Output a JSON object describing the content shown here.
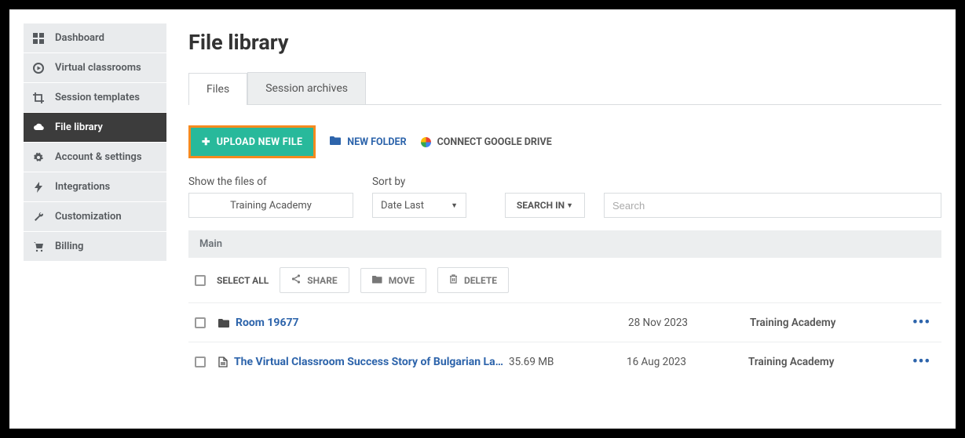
{
  "page_title": "File library",
  "sidebar": {
    "items": [
      {
        "id": "dashboard",
        "label": "Dashboard",
        "active": false
      },
      {
        "id": "virtual-classrooms",
        "label": "Virtual classrooms",
        "active": false
      },
      {
        "id": "session-templates",
        "label": "Session templates",
        "active": false
      },
      {
        "id": "file-library",
        "label": "File library",
        "active": true
      },
      {
        "id": "account-settings",
        "label": "Account & settings",
        "active": false
      },
      {
        "id": "integrations",
        "label": "Integrations",
        "active": false
      },
      {
        "id": "customization",
        "label": "Customization",
        "active": false
      },
      {
        "id": "billing",
        "label": "Billing",
        "active": false
      }
    ]
  },
  "tabs": [
    {
      "id": "files",
      "label": "Files",
      "active": true
    },
    {
      "id": "session-archives",
      "label": "Session archives",
      "active": false
    }
  ],
  "actions": {
    "upload_label": "UPLOAD NEW FILE",
    "new_folder_label": "NEW FOLDER",
    "connect_drive_label": "CONNECT GOOGLE DRIVE"
  },
  "filters": {
    "show_files_label": "Show the files of",
    "show_files_value": "Training Academy",
    "sort_by_label": "Sort by",
    "sort_by_value": "Date Last",
    "search_in_label": "SEARCH IN",
    "search_placeholder": "Search"
  },
  "breadcrumb": "Main",
  "toolbar": {
    "select_all_label": "SELECT ALL",
    "share_label": "SHARE",
    "move_label": "MOVE",
    "delete_label": "DELETE"
  },
  "rows": [
    {
      "type": "folder",
      "name": "Room 19677",
      "size": "",
      "date": "28 Nov 2023",
      "owner": "Training Academy"
    },
    {
      "type": "file",
      "name": "The Virtual Classroom Success Story of Bulgarian Lang…",
      "size": "35.69 MB",
      "date": "16 Aug 2023",
      "owner": "Training Academy"
    }
  ]
}
